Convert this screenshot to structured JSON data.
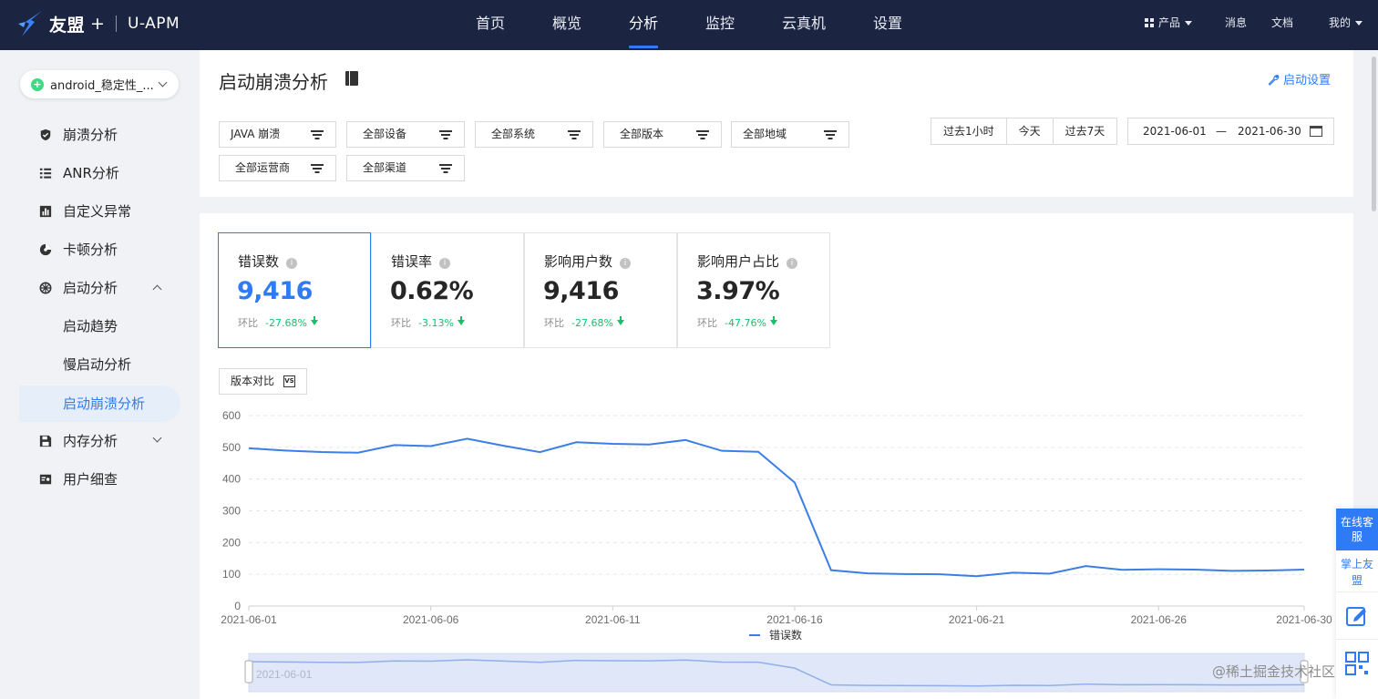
{
  "brand": {
    "name": "友盟",
    "plus": "+",
    "product": "U-APM"
  },
  "nav": {
    "items": [
      "首页",
      "概览",
      "分析",
      "监控",
      "云真机",
      "设置"
    ],
    "active": "分析"
  },
  "nav_right": {
    "product": "产品",
    "messages": "消息",
    "docs": "文档",
    "me": "我的"
  },
  "app_select": {
    "label": "android_稳定性_..."
  },
  "sidebar": {
    "items": [
      {
        "label": "崩溃分析",
        "icon": "shield-icon"
      },
      {
        "label": "ANR分析",
        "icon": "list-icon"
      },
      {
        "label": "自定义异常",
        "icon": "bar-chart-icon"
      },
      {
        "label": "卡顿分析",
        "icon": "stutter-icon"
      },
      {
        "label": "启动分析",
        "icon": "launch-icon"
      },
      {
        "label": "启动趋势"
      },
      {
        "label": "慢启动分析"
      },
      {
        "label": "启动崩溃分析"
      },
      {
        "label": "内存分析",
        "icon": "save-icon"
      },
      {
        "label": "用户细查",
        "icon": "id-card-icon"
      }
    ],
    "active": "启动崩溃分析"
  },
  "page": {
    "title": "启动崩溃分析",
    "settings_link": "启动设置"
  },
  "filters": [
    "JAVA 崩溃",
    "全部设备",
    "全部系统",
    "全部版本",
    "全部地域",
    "全部运营商",
    "全部渠道"
  ],
  "time_buttons": [
    "过去1小时",
    "今天",
    "过去7天"
  ],
  "date_range": {
    "start": "2021-06-01",
    "separator": "—",
    "end": "2021-06-30"
  },
  "metrics": [
    {
      "label": "错误数",
      "value": "9,416",
      "compare_label": "环比",
      "delta": "-27.68%"
    },
    {
      "label": "错误率",
      "value": "0.62%",
      "compare_label": "环比",
      "delta": "-3.13%"
    },
    {
      "label": "影响用户数",
      "value": "9,416",
      "compare_label": "环比",
      "delta": "-27.68%"
    },
    {
      "label": "影响用户占比",
      "value": "3.97%",
      "compare_label": "环比",
      "delta": "-47.76%"
    }
  ],
  "version_compare": {
    "label": "版本对比",
    "icon_text": "VS"
  },
  "chart_data": {
    "type": "line",
    "x": [
      "2021-06-01",
      "2021-06-02",
      "2021-06-03",
      "2021-06-04",
      "2021-06-05",
      "2021-06-06",
      "2021-06-07",
      "2021-06-08",
      "2021-06-09",
      "2021-06-10",
      "2021-06-11",
      "2021-06-12",
      "2021-06-13",
      "2021-06-14",
      "2021-06-15",
      "2021-06-16",
      "2021-06-17",
      "2021-06-18",
      "2021-06-19",
      "2021-06-20",
      "2021-06-21",
      "2021-06-22",
      "2021-06-23",
      "2021-06-24",
      "2021-06-25",
      "2021-06-26",
      "2021-06-27",
      "2021-06-28",
      "2021-06-29",
      "2021-06-30"
    ],
    "series": [
      {
        "name": "错误数",
        "values": [
          497,
          490,
          485,
          483,
          507,
          504,
          527,
          505,
          485,
          516,
          511,
          509,
          523,
          489,
          486,
          389,
          113,
          103,
          101,
          100,
          94,
          105,
          102,
          126,
          114,
          116,
          115,
          111,
          112,
          115
        ]
      }
    ],
    "xticks": [
      "2021-06-01",
      "2021-06-06",
      "2021-06-11",
      "2021-06-16",
      "2021-06-21",
      "2021-06-26",
      "2021-06-30"
    ],
    "yticks": [
      0,
      100,
      200,
      300,
      400,
      500,
      600
    ],
    "ylim": [
      0,
      600
    ],
    "grid": true,
    "legend": "bottom-center",
    "color": "#3b7fe6",
    "zoom_label": "2021-06-01"
  },
  "float_panel": {
    "online_service": "在线客服",
    "mobile_app": "掌上友盟"
  },
  "watermark": "@稀土掘金技术社区",
  "colors": {
    "primary": "#2f7bf5",
    "nav_bg": "#1b2541",
    "positive": "#19be6b"
  }
}
